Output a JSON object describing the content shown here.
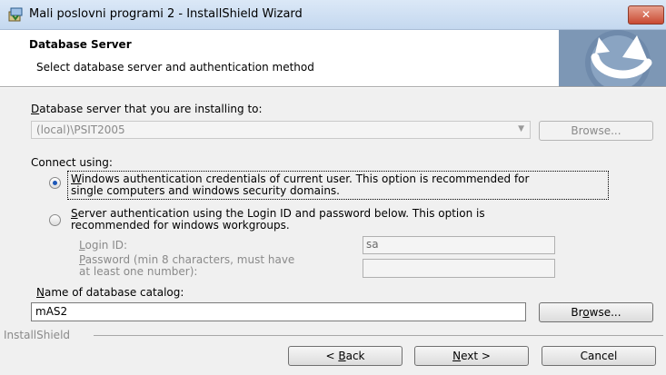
{
  "window": {
    "title": "Mali poslovni programi 2 - InstallShield Wizard",
    "close_glyph": "✕"
  },
  "banner": {
    "title": "Database Server",
    "subtitle": "Select database server and authentication method"
  },
  "server": {
    "label_key": "D",
    "label_rest": "atabase server that you are installing to:",
    "value": "(local)\\PSIT2005",
    "browse_label": "Browse..."
  },
  "connect": {
    "label": "Connect using:",
    "windows_auth": {
      "line1_key": "W",
      "line1_rest": "indows authentication credentials of current user. This option is recommended for",
      "line2": "single computers and windows security domains.",
      "selected": true
    },
    "server_auth": {
      "line1_key": "S",
      "line1_rest": "erver authentication using the Login ID and password below. This option is",
      "line2": "recommended for windows workgroups.",
      "selected": false
    },
    "login_id": {
      "label_key": "L",
      "label_rest": "ogin ID:",
      "value": "sa"
    },
    "password": {
      "line1_key": "P",
      "line1_rest": "assword (min 8 characters, must have",
      "line2": "at least one number):",
      "value": ""
    }
  },
  "catalog": {
    "label_key": "N",
    "label_rest": "ame of database catalog:",
    "value": "mAS2",
    "browse_pre": "Br",
    "browse_key": "o",
    "browse_post": "wse..."
  },
  "footer": {
    "brand": "InstallShield",
    "back_pre": "< ",
    "back_key": "B",
    "back_post": "ack",
    "next_key": "N",
    "next_post": "ext >",
    "cancel_label": "Cancel"
  },
  "colors": {
    "accent": "#1c57b8",
    "close": "#c94a32",
    "logo": "#7d97b5"
  }
}
